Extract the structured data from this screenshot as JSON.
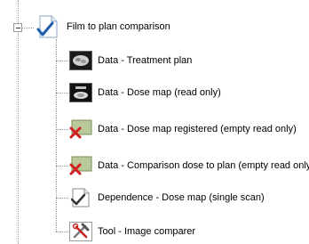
{
  "tree": {
    "root": {
      "label": "Film to plan comparison",
      "icon": "document-check-icon",
      "expanded": true
    },
    "children": [
      {
        "label": "Data - Treatment plan",
        "icon": "treatment-plan-image-icon"
      },
      {
        "label": "Data - Dose map (read only)",
        "icon": "dose-map-image-icon"
      },
      {
        "label": "Data - Dose map registered (empty read only)",
        "icon": "empty-data-x-icon"
      },
      {
        "label": "Data - Comparison dose to plan (empty read only)",
        "icon": "empty-data-x-icon"
      },
      {
        "label": "Dependence - Dose map (single scan)",
        "icon": "dependence-check-icon"
      },
      {
        "label": "Tool - Image comparer",
        "icon": "tool-hammer-wrench-icon"
      }
    ]
  }
}
